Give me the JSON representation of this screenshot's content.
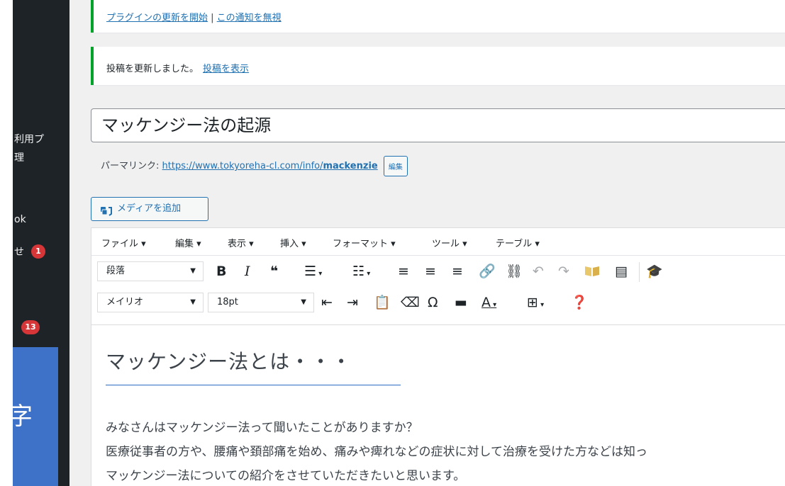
{
  "sidebar": {
    "items": [
      {
        "label": "利用プ"
      },
      {
        "label": "理"
      },
      {
        "label": "ok"
      },
      {
        "label": "せ"
      }
    ],
    "badges": [
      "1",
      "13"
    ],
    "overlay_char": "字"
  },
  "notices": {
    "plugin_update_link": "プラグインの更新を開始",
    "plugin_sep": " | ",
    "plugin_dismiss_link": "この通知を無視",
    "updated_text": "投稿を更新しました。",
    "view_post_link": "投稿を表示"
  },
  "post": {
    "title": "マッケンジー法の起源"
  },
  "permalink": {
    "label": "パーマリンク:",
    "url_prefix": "https://www.tokyoreha-cl.com/info/",
    "slug": "mackenzie",
    "edit_label": "編集"
  },
  "media_button": {
    "label": "メディアを追加"
  },
  "menubar": [
    "ファイル ▾",
    "編集 ▾",
    "表示 ▾",
    "挿入 ▾",
    "フォーマット ▾",
    "ツール ▾",
    "テーブル ▾"
  ],
  "toolbar": {
    "block_format": "段落",
    "font_family": "メイリオ",
    "font_size": "18pt"
  },
  "content": {
    "heading": "マッケンジー法とは・・・",
    "paragraphs": [
      "みなさんはマッケンジー法って聞いたことがありますか？",
      "医療従事者の方や、腰痛や頚部痛を始め、痛みや痺れなどの症状に対して治療を受けた方などは知っ",
      "マッケンジー法についての紹介をさせていただきたいと思います。"
    ]
  },
  "colors": {
    "sidebar_bg": "#1d2327",
    "accent": "#2271b1",
    "notice_green": "#00a32a",
    "badge_red": "#d63638",
    "overlay_blue": "#3d72c8"
  }
}
